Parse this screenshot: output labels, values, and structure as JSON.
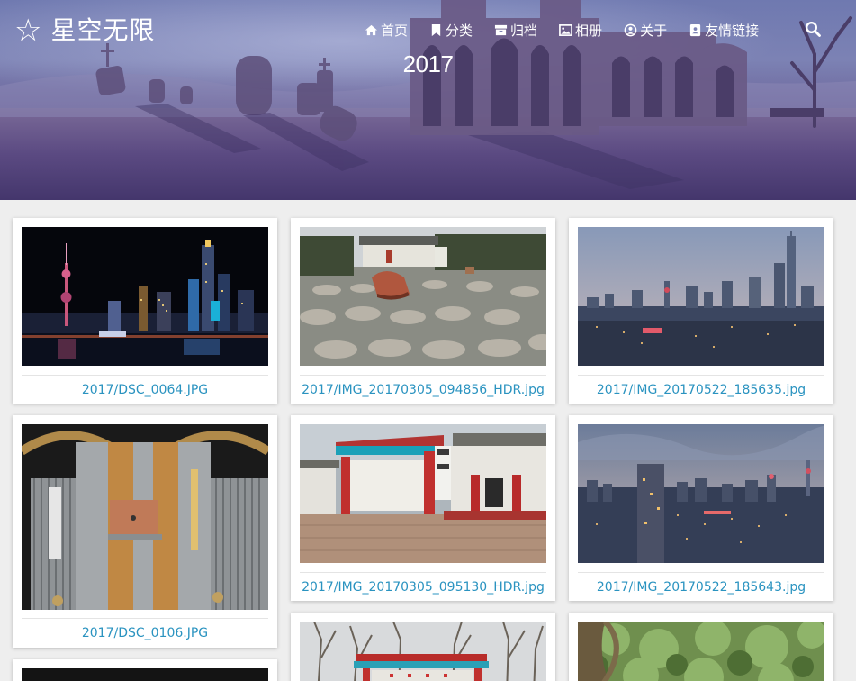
{
  "site": {
    "logo_glyph": "☆",
    "name": "星空无限"
  },
  "nav": {
    "items": [
      {
        "label": "首页",
        "icon": "home-icon"
      },
      {
        "label": "分类",
        "icon": "bookmark-icon"
      },
      {
        "label": "归档",
        "icon": "archive-icon"
      },
      {
        "label": "相册",
        "icon": "image-icon"
      },
      {
        "label": "关于",
        "icon": "user-circle-icon"
      },
      {
        "label": "友情链接",
        "icon": "address-book-icon"
      }
    ],
    "search_icon": "search-icon"
  },
  "page": {
    "title": "2017"
  },
  "colors": {
    "caption_link": "#2a93c0",
    "background": "#eeeeee"
  },
  "gallery": {
    "photos": [
      {
        "caption": "2017/DSC_0064.JPG",
        "scene": "night-skyline-tower"
      },
      {
        "caption": "2017/IMG_20170305_094856_HDR.jpg",
        "scene": "stone-paved-courtyard"
      },
      {
        "caption": "2017/IMG_20170522_185635.jpg",
        "scene": "dusk-city-skyline"
      },
      {
        "caption": "2017/DSC_0106.JPG",
        "scene": "heatsink-closeup"
      },
      {
        "caption": "2017/IMG_20170305_095130_HDR.jpg",
        "scene": "red-stage-building"
      },
      {
        "caption": "2017/IMG_20170522_185643.jpg",
        "scene": "evening-city-skyline"
      },
      {
        "caption": "",
        "scene": "dark-partial"
      },
      {
        "caption": "",
        "scene": "trees-red-gate"
      },
      {
        "caption": "",
        "scene": "green-tree-canopy"
      }
    ]
  }
}
